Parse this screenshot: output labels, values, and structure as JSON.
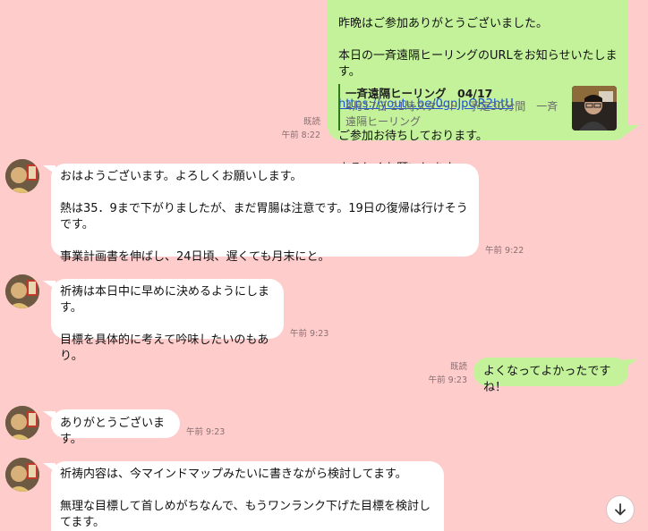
{
  "colors": {
    "background": "#ffcccc",
    "sent_bubble": "#c3f29a",
    "received_bubble": "#ffffff",
    "link": "#1d4fd8",
    "meta_text": "#8a6f70"
  },
  "messages": {
    "m1": {
      "lines": [
        "昨晩はご参加ありがとうございました。",
        "本日の一斉遠隔ヒーリングのURLをお知らせいたします。"
      ],
      "link": "https://youtu.be/0gnJpQR2htU",
      "lines_after": [
        "ご参加お待ちしております。",
        "よろしくお願いします。"
      ],
      "preview": {
        "title": "一斉遠隔ヒーリング　04/17",
        "description": "4月17日 21時スタート　予定30分間　一斉遠隔ヒーリング"
      },
      "read": "既読",
      "time": "午前 8:22"
    },
    "m2": {
      "text": "おはようございます。よろしくお願いします。\n\n熱は35．9まで下がりましたが、まだ胃腸は注意です。19日の復帰は行けそうです。\n\n事業計画書を伸ばし、24日頃、遅くても月末にと。",
      "time": "午前 9:22"
    },
    "m3": {
      "text": "祈祷は本日中に早めに決めるようにします。\n\n目標を具体的に考えて吟味したいのもあり。",
      "time": "午前 9:23"
    },
    "m4": {
      "text": "よくなってよかったですね！",
      "read": "既読",
      "time": "午前 9:23"
    },
    "m5": {
      "text": "ありがとうございます。",
      "time": "午前 9:23"
    },
    "m6": {
      "text": "祈祷内容は、今マインドマップみたいに書きながら検討してます。\n\n無理な目標して首しめがちなんで、もうワンランク下げた目標を検討してます。"
    }
  },
  "icons": {
    "avatar": "user-avatar",
    "scroll": "arrow-down-icon"
  }
}
